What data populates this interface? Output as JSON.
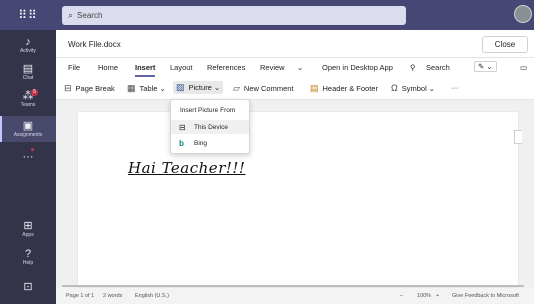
{
  "header": {
    "search_placeholder": "Search",
    "waffle_icon": "waffle-icon",
    "avatar_icon": "avatar"
  },
  "rail": {
    "items": [
      {
        "label": "Activity",
        "icon": "bell-icon"
      },
      {
        "label": "Chat",
        "icon": "chat-icon"
      },
      {
        "label": "Teams",
        "icon": "teams-icon",
        "badge": "5"
      },
      {
        "label": "Assignments",
        "icon": "assignments-icon"
      },
      {
        "label": "",
        "icon": "more-icon"
      }
    ],
    "apps_label": "Apps",
    "help_label": "Help"
  },
  "document": {
    "title": "Work File.docx",
    "close_label": "Close",
    "body_text": "Hai Teacher!!!"
  },
  "ribbon": {
    "tabs": [
      "File",
      "Home",
      "Insert",
      "Layout",
      "References",
      "Review"
    ],
    "active_tab": "Insert",
    "open_desktop": "Open in Desktop App",
    "search": "Search",
    "commands": {
      "page_break": "Page Break",
      "table": "Table",
      "picture": "Picture",
      "new_comment": "New Comment",
      "header_footer": "Header & Footer",
      "symbol": "Symbol",
      "more": "···"
    }
  },
  "picture_menu": {
    "header": "Insert Picture From",
    "items": [
      "This Device",
      "Bing"
    ]
  },
  "status_bar": {
    "page": "Page 1 of 1",
    "words": "2 words",
    "language": "English (U.S.)",
    "zoom_minus": "–",
    "zoom": "100%",
    "zoom_plus": "+",
    "feedback": "Give Feedback to Microsoft"
  },
  "colors": {
    "topbar": "#464775",
    "rail": "#33344a",
    "accent": "#6264a7",
    "bing": "#0c8484",
    "badge": "#c4314b"
  }
}
